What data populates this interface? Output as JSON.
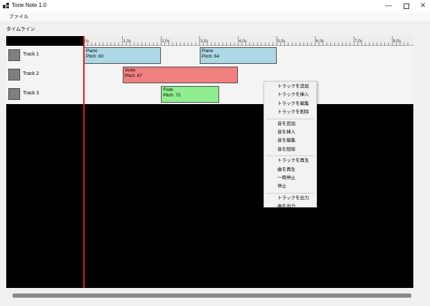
{
  "window": {
    "title": "Tone Note 1.0",
    "min_glyph": "—",
    "close_glyph": "✕"
  },
  "menu": {
    "file": "ファイル"
  },
  "section_label": "タイムライン",
  "ruler": {
    "labels": [
      "0s",
      "1.0s",
      "2.0s",
      "3.0s",
      "4.0s",
      "5.0s",
      "6.0s",
      "7.0s",
      "8.0s"
    ]
  },
  "tracks": [
    {
      "name": "Track 1"
    },
    {
      "name": "Track 2"
    },
    {
      "name": "Track 3"
    }
  ],
  "notes": [
    {
      "track": 1,
      "instrument": "Piano",
      "pitch": "Pitch: 60",
      "start_s": 0.0,
      "end_s": 2.0,
      "color": "#add8e6"
    },
    {
      "track": 1,
      "instrument": "Piano",
      "pitch": "Pitch: 64",
      "start_s": 3.0,
      "end_s": 5.0,
      "color": "#add8e6"
    },
    {
      "track": 2,
      "instrument": "Violin",
      "pitch": "Pitch: 67",
      "start_s": 1.0,
      "end_s": 4.0,
      "color": "#f08080"
    },
    {
      "track": 3,
      "instrument": "Flute",
      "pitch": "Pitch: 72",
      "start_s": 2.0,
      "end_s": 3.5,
      "color": "#90ee90"
    }
  ],
  "playhead_s": 0.0,
  "context_menu": [
    [
      "トラックを追加",
      "トラックを挿入",
      "トラックを編集",
      "トラックを削除"
    ],
    [
      "音を追加",
      "音を挿入",
      "音を編集",
      "音を削除"
    ],
    [
      "トラックを再生",
      "曲を再生",
      "一時停止",
      "停止"
    ],
    [
      "トラックを出力",
      "曲を出力"
    ]
  ],
  "colors": {
    "playhead": "#e41818",
    "timeline_bg": "#000000",
    "track_bg": "#f4f4f4"
  }
}
